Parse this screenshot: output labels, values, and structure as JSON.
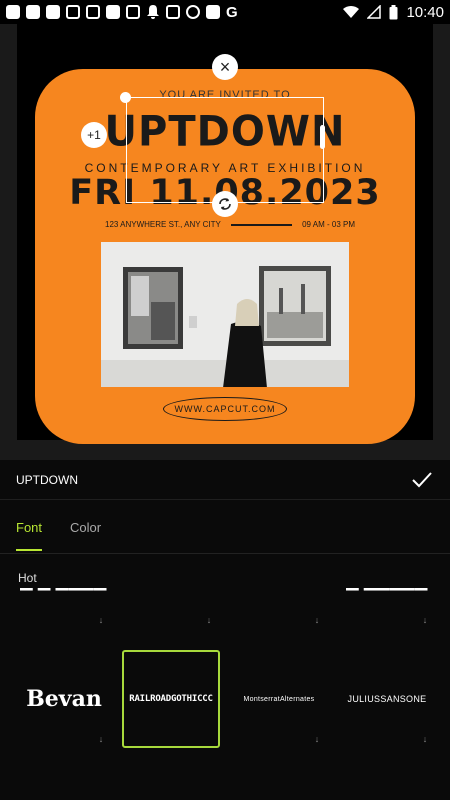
{
  "status_bar": {
    "time": "10:40",
    "icons": [
      "app-icon",
      "app-icon",
      "app-icon",
      "calendar-icon",
      "calendar-icon",
      "slash-icon",
      "grid-icon",
      "bell-icon",
      "edit-icon",
      "number-icon",
      "square-icon",
      "google-icon",
      "wifi-icon",
      "signal-icon",
      "battery-icon"
    ]
  },
  "poster": {
    "invited_text": "YOU ARE INVITED TO",
    "title": "UPTDOWN",
    "subtitle": "CONTEMPORARY ART EXHIBITION",
    "date": "FRI 11.08.2023",
    "address": "123 ANYWHERE ST., ANY CITY",
    "hours": "09 AM - 03 PM",
    "website": "WWW.CAPCUT.COM",
    "background_color": "#f6861f"
  },
  "selection": {
    "close_glyph": "×",
    "plus_label": "+1"
  },
  "panel": {
    "text_value": "UPTDOWN",
    "tabs": [
      {
        "label": "Font",
        "active": true
      },
      {
        "label": "Color",
        "active": false
      }
    ],
    "section_label": "Hot",
    "fonts": [
      {
        "label": "Bevan",
        "selected": false
      },
      {
        "label": "RAILROADGOTHICCC",
        "selected": true
      },
      {
        "label": "MontserratAlternates",
        "selected": false
      },
      {
        "label": "JULIUSSANSONE",
        "selected": false
      }
    ],
    "accent_color": "#b8e633"
  }
}
